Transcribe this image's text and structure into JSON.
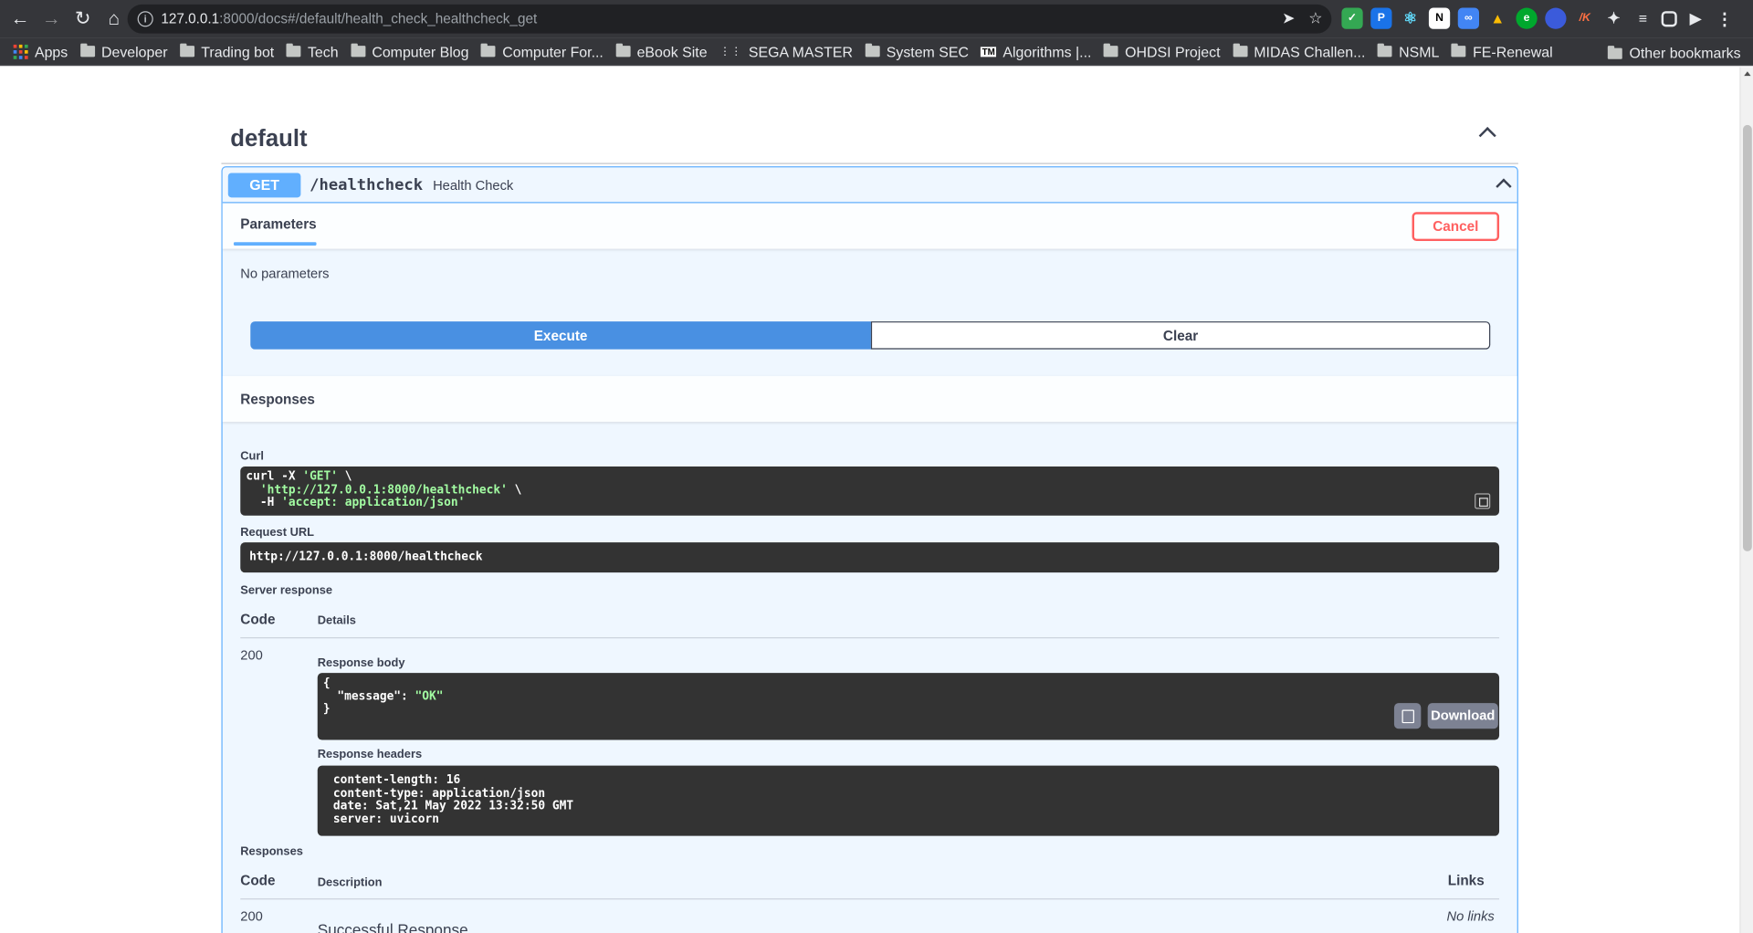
{
  "browser": {
    "url_host": "127.0.0.1",
    "url_rest": ":8000/docs#/default/health_check_healthcheck_get",
    "bookmarks": [
      "Apps",
      "Developer",
      "Trading bot",
      "Tech",
      "Computer Blog",
      "Computer For...",
      "eBook Site",
      "SEGA MASTER",
      "System SEC",
      "Algorithms |...",
      "OHDSI Project",
      "MIDAS Challen...",
      "NSML",
      "FE-Renewal"
    ],
    "other_bookmarks": "Other bookmarks"
  },
  "tag": {
    "title": "default"
  },
  "operation": {
    "method": "GET",
    "path": "/healthcheck",
    "description": "Health Check",
    "parameters_tab": "Parameters",
    "cancel_label": "Cancel",
    "no_params": "No parameters",
    "execute_label": "Execute",
    "clear_label": "Clear"
  },
  "responses": {
    "title": "Responses",
    "curl_label": "Curl",
    "curl": {
      "l1_prefix": "curl -X ",
      "l1_method": "'GET'",
      "l1_suffix": " \\",
      "l2_url": "'http://127.0.0.1:8000/healthcheck'",
      "l2_suffix": " \\",
      "l3_prefix": "-H ",
      "l3_header": "'accept: application/json'"
    },
    "request_url_label": "Request URL",
    "request_url": "http://127.0.0.1:8000/healthcheck",
    "server_response_label": "Server response",
    "code_header": "Code",
    "details_header": "Details",
    "code": "200",
    "response_body_label": "Response body",
    "body": {
      "open": "{",
      "key": "\"message\"",
      "colon": ": ",
      "value": "\"OK\"",
      "close": "}"
    },
    "download_label": "Download",
    "response_headers_label": "Response headers",
    "headers": [
      "content-length: 16",
      "content-type: application/json",
      "date: Sat,21 May 2022 13:32:50 GMT",
      "server: uvicorn"
    ],
    "responses_label": "Responses",
    "code_header2": "Code",
    "description_header": "Description",
    "links_header": "Links",
    "code2": "200",
    "no_links": "No links",
    "successful_response": "Successful Response"
  }
}
